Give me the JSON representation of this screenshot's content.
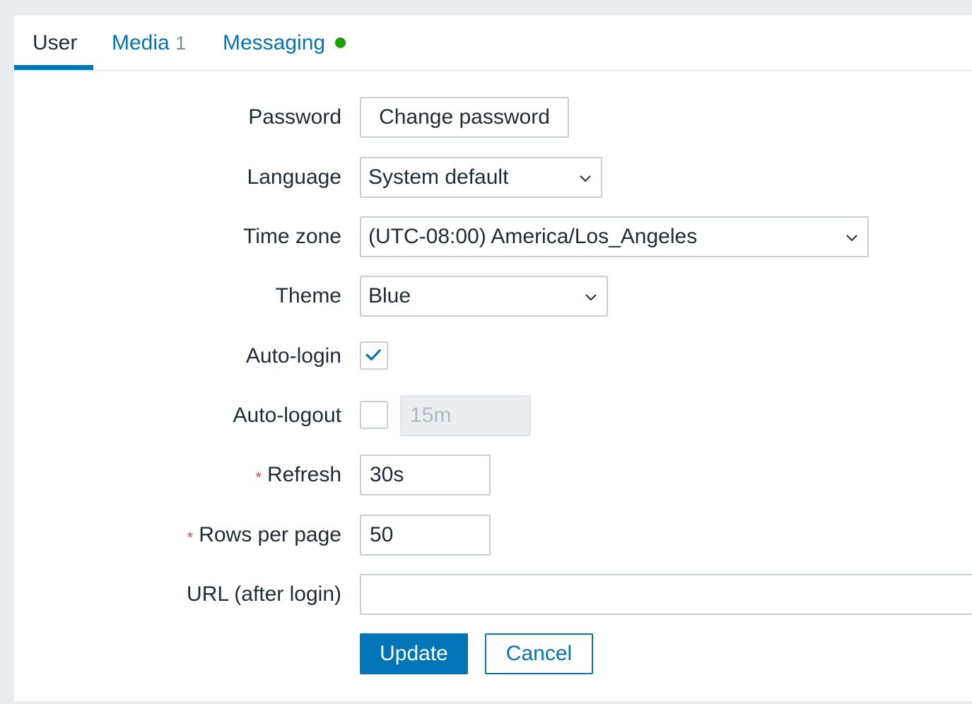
{
  "tabs": [
    {
      "label": "User",
      "active": true
    },
    {
      "label": "Media",
      "count": "1"
    },
    {
      "label": "Messaging",
      "status_color": "#19a100"
    }
  ],
  "form": {
    "password": {
      "label": "Password",
      "button": "Change password"
    },
    "language": {
      "label": "Language",
      "value": "System default"
    },
    "timezone": {
      "label": "Time zone",
      "value": "(UTC-08:00) America/Los_Angeles"
    },
    "theme": {
      "label": "Theme",
      "value": "Blue"
    },
    "autologin": {
      "label": "Auto-login",
      "checked": true
    },
    "autologout": {
      "label": "Auto-logout",
      "checked": false,
      "value": "15m"
    },
    "refresh": {
      "label": "Refresh",
      "required_mark": "*",
      "value": "30s"
    },
    "rows_per_page": {
      "label": "Rows per page",
      "required_mark": "*",
      "value": "50"
    },
    "url": {
      "label": "URL (after login)",
      "value": ""
    }
  },
  "actions": {
    "update": "Update",
    "cancel": "Cancel"
  },
  "colors": {
    "accent": "#0275b8",
    "required": "#d64e4e",
    "status_green": "#19a100"
  },
  "icons": {
    "dropdown": "chevron-down-icon",
    "check": "checkmark-icon"
  }
}
